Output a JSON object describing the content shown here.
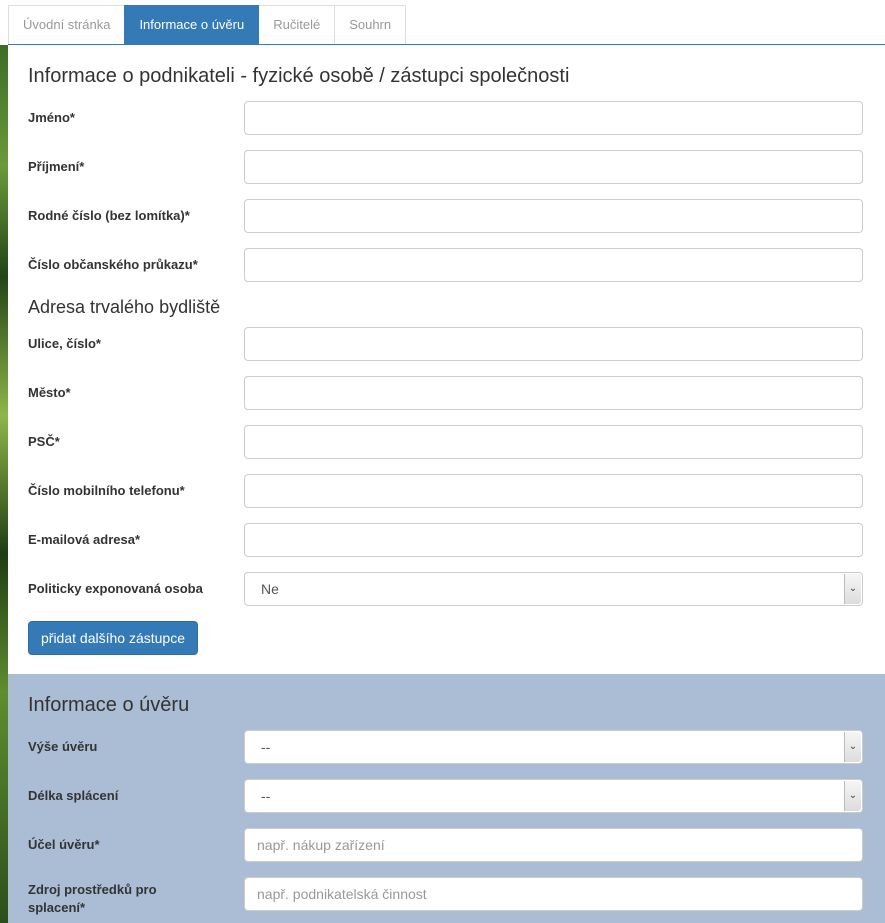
{
  "tabs": [
    {
      "label": "Úvodní stránka"
    },
    {
      "label": "Informace o úvěru"
    },
    {
      "label": "Ručitelé"
    },
    {
      "label": "Souhrn"
    }
  ],
  "section_person": {
    "title": "Informace o podnikateli - fyzické osobě / zástupci společnosti",
    "first_name_label": "Jméno*",
    "last_name_label": "Příjmení*",
    "birth_number_label": "Rodné číslo (bez lomítka)*",
    "id_card_label": "Číslo občanského průkazu*"
  },
  "section_address": {
    "title": "Adresa trvalého bydliště",
    "street_label": "Ulice, číslo*",
    "city_label": "Město*",
    "zip_label": "PSČ*",
    "mobile_label": "Číslo mobilního telefonu*",
    "email_label": "E-mailová adresa*",
    "pep_label": "Politicky exponovaná osoba",
    "pep_value": "Ne",
    "add_button": "přidat dalšího zástupce"
  },
  "section_loan": {
    "title": "Informace o úvěru",
    "amount_label": "Výše úvěru",
    "amount_value": "--",
    "term_label": "Délka splácení",
    "term_value": "--",
    "purpose_label": "Účel úvěru*",
    "purpose_placeholder": "např. nákup zařízení",
    "source_label_line1": "Zdroj prostředků pro",
    "source_label_line2": "splacení*",
    "source_placeholder": "např. podnikatelská činnost"
  },
  "colors": {
    "accent": "#337ab7",
    "loan_panel_bg": "#aabdd4"
  }
}
